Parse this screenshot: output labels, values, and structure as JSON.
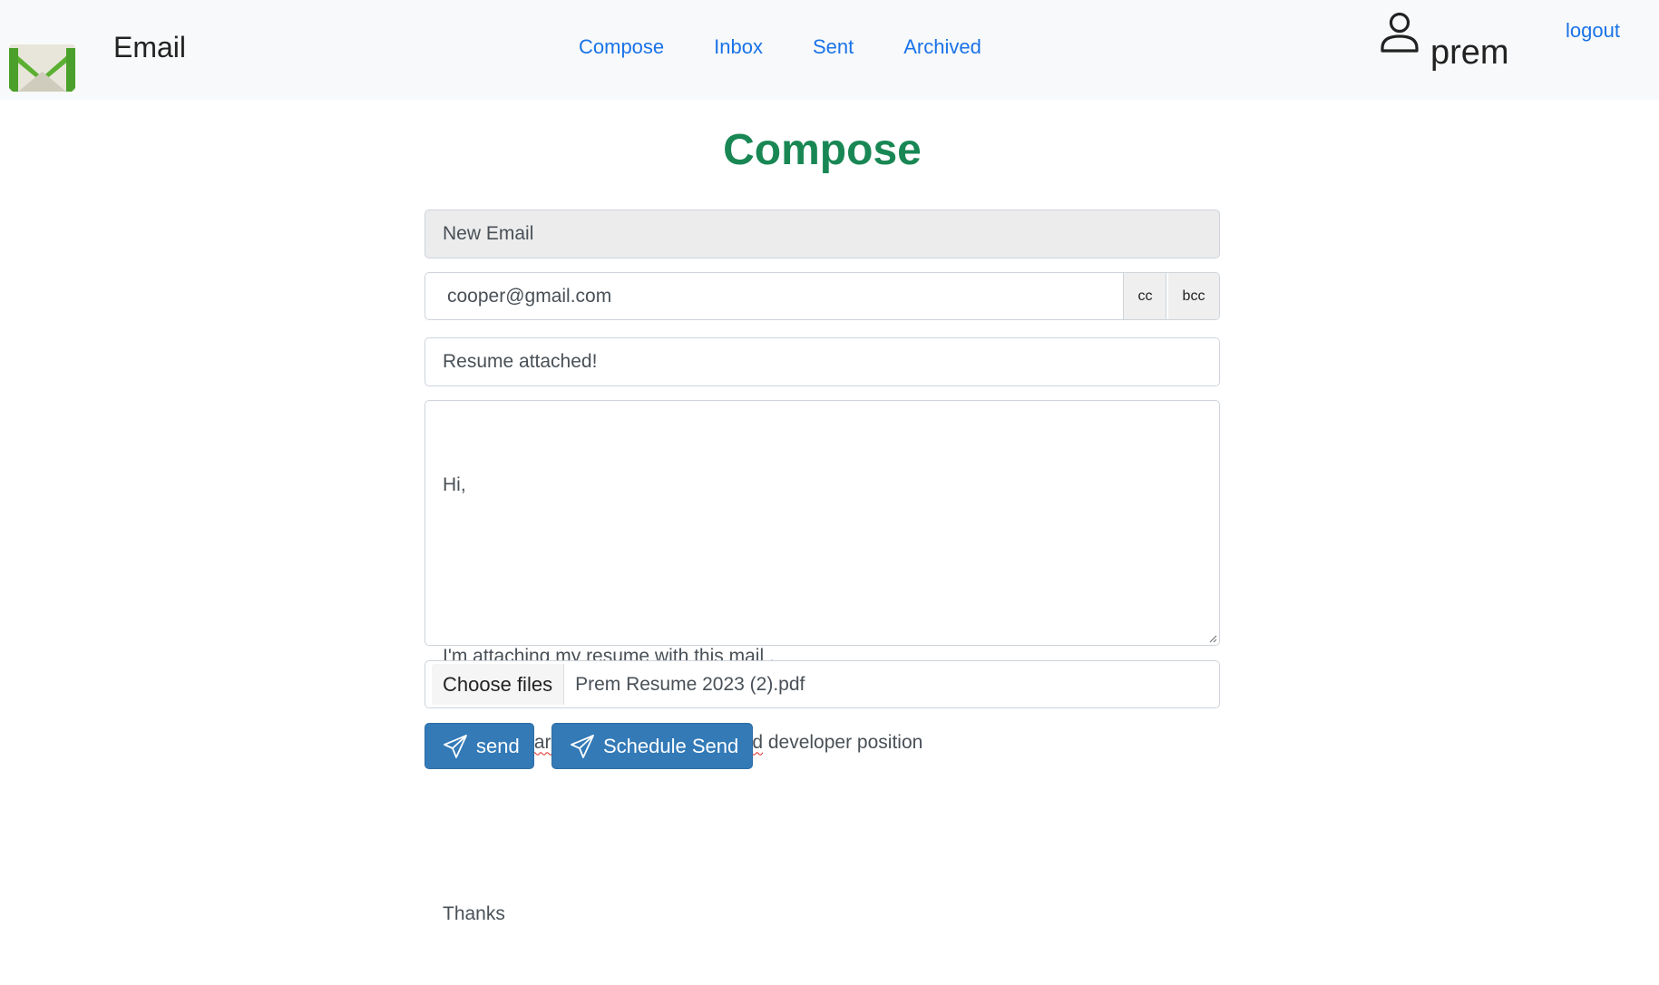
{
  "navbar": {
    "brand": "Email",
    "links": [
      "Compose",
      "Inbox",
      "Sent",
      "Archived"
    ],
    "user": "prem",
    "logout": "logout"
  },
  "page": {
    "title": "Compose"
  },
  "form": {
    "header": "New Email",
    "to_value": "cooper@gmail.com",
    "cc_label": "cc",
    "bcc_label": "bcc",
    "subject": "Resume attached!",
    "body_lines": [
      "Hi,",
      "",
      "I'm attaching my resume with this mail .",
      "I'm particularily  looking for a Backend developer position",
      "",
      "Thanks"
    ],
    "file_button": "Choose files",
    "file_name": "Prem Resume 2023 (2).pdf",
    "send_label": "send",
    "schedule_label": "Schedule Send"
  },
  "icons": {
    "logo": "gmail-envelope-icon",
    "user": "user-icon",
    "send": "paper-plane-icon"
  },
  "colors": {
    "link": "#1a73e8",
    "title": "#198754",
    "button": "#337ab7",
    "navbar_bg": "#f8f9fa"
  }
}
